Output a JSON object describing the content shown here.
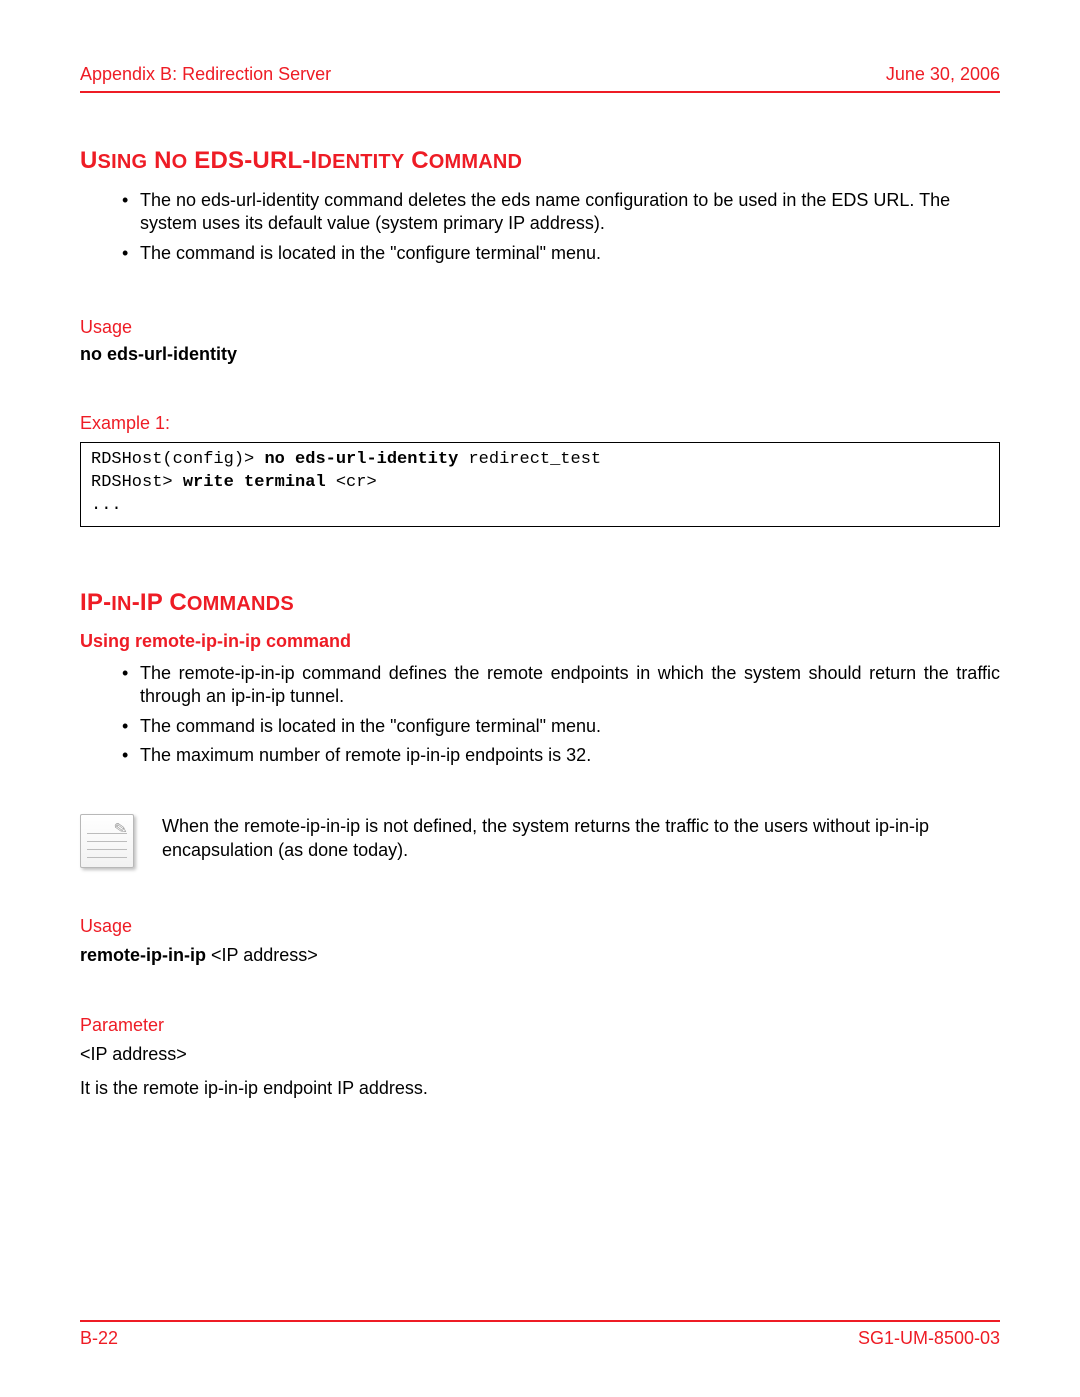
{
  "header": {
    "left": "Appendix B: Redirection Server",
    "right": "June 30, 2006"
  },
  "footer": {
    "left": "B-22",
    "right": "SG1-UM-8500-03"
  },
  "section1": {
    "title": "Using No EDS-URL-Identity Command",
    "bullets": [
      "The no eds-url-identity command deletes the eds name configuration to be used in the EDS URL. The system uses its default value (system primary IP address).",
      "The command is located in the \"configure terminal\" menu."
    ],
    "usage_label": "Usage",
    "usage_cmd": "no eds-url-identity",
    "example_label": "Example 1:",
    "code": {
      "line1_prefix": "RDSHost(config)> ",
      "line1_bold": "no eds-url-identity",
      "line1_suffix": " redirect_test",
      "line2_prefix": "RDSHost> ",
      "line2_bold": "write terminal",
      "line2_suffix": " <cr>",
      "line3": "..."
    }
  },
  "section2": {
    "title": "IP-in-IP Commands",
    "subtitle": "Using remote-ip-in-ip command",
    "bullets": [
      "The remote-ip-in-ip command defines the remote endpoints in which the system should return the traffic through an ip-in-ip tunnel.",
      "The command is located in the \"configure terminal\" menu.",
      "The maximum number of remote ip-in-ip endpoints is 32."
    ],
    "note": "When the remote-ip-in-ip is not defined, the system returns the traffic to the users without ip-in-ip encapsulation (as done today).",
    "usage_label": "Usage",
    "usage_cmd": "remote-ip-in-ip",
    "usage_arg": " <IP address>",
    "param_label": "Parameter",
    "param_name": "<IP address>",
    "param_desc": "It is the remote ip-in-ip endpoint IP address."
  }
}
